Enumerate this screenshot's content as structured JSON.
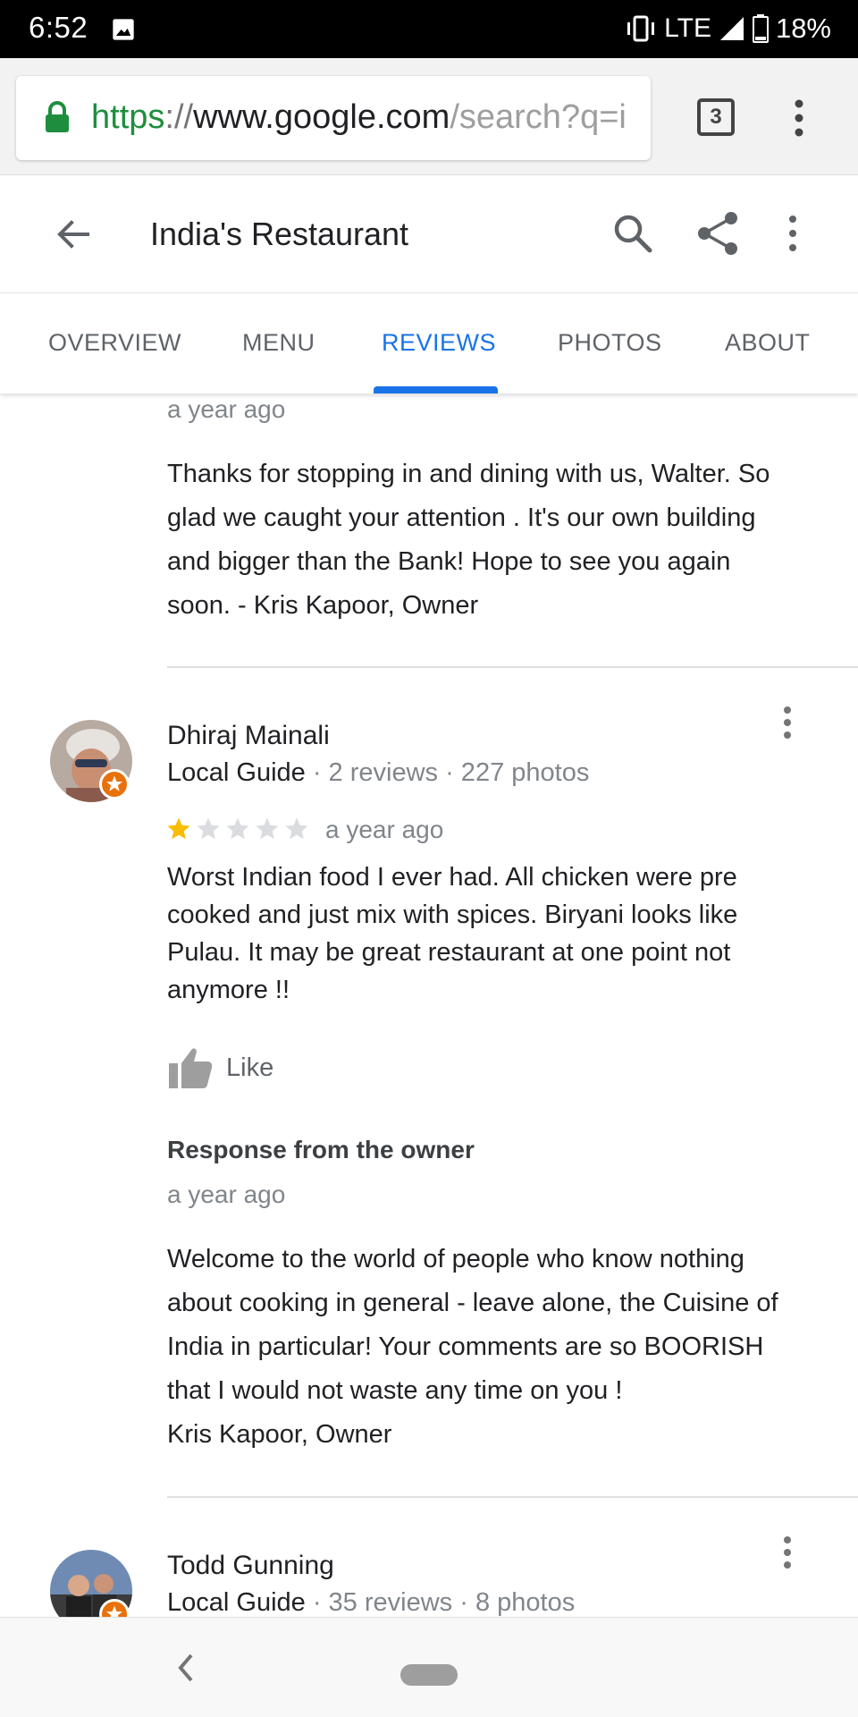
{
  "status_bar": {
    "time": "6:52",
    "network": "LTE",
    "battery": "18%"
  },
  "browser": {
    "url_scheme": "https",
    "url_sep": "://",
    "url_host": "www.google.com",
    "url_rest": "/search?q=i",
    "tab_count": "3"
  },
  "header": {
    "title": "India's Restaurant"
  },
  "tabs": [
    {
      "label": "OVERVIEW"
    },
    {
      "label": "MENU"
    },
    {
      "label": "REVIEWS"
    },
    {
      "label": "PHOTOS"
    },
    {
      "label": "ABOUT"
    }
  ],
  "active_tab": "REVIEWS",
  "reviews": {
    "prev_owner_response": {
      "time": "a year ago",
      "lines": [
        "Thanks for stopping in and dining with us, Walter. So",
        "glad we caught your attention . It's our own building",
        "and bigger than the Bank! Hope to see you again",
        "soon. - Kris Kapoor, Owner"
      ]
    },
    "items": [
      {
        "name": "Dhiraj Mainali",
        "guide": "Local Guide",
        "stats": " · 2 reviews · 227 photos",
        "rating": 1,
        "max_rating": 5,
        "time": "a year ago",
        "text_lines": [
          "Worst Indian food I ever had. All chicken were pre",
          "cooked and just mix with spices. Biryani looks like",
          "Pulau. It may be great restaurant at one point not",
          "anymore !!"
        ],
        "like_label": "Like",
        "owner_response": {
          "heading": "Response from the owner",
          "time": "a year ago",
          "lines": [
            "Welcome to the world of people who know nothing",
            "about cooking in general - leave alone, the Cuisine of",
            "India in particular! Your comments are so BOORISH",
            "that I would not waste any time on you !",
            "Kris Kapoor, Owner"
          ]
        }
      },
      {
        "name": "Todd Gunning",
        "guide": "Local Guide",
        "stats": " · 35 reviews · 8 photos"
      }
    ]
  },
  "colors": {
    "accent": "#1a73e8",
    "star_filled": "#fbbc04",
    "star_empty": "#dadce0",
    "lock_green": "#1e8e3e",
    "local_guide_badge": "#e8710a"
  },
  "icons": [
    "image-icon",
    "vibrate-icon",
    "signal-icon",
    "battery-icon",
    "lock-icon",
    "back-arrow-icon",
    "search-icon",
    "share-icon",
    "more-vert-icon",
    "thumbs-up-icon",
    "star-icon",
    "nav-back-icon"
  ]
}
